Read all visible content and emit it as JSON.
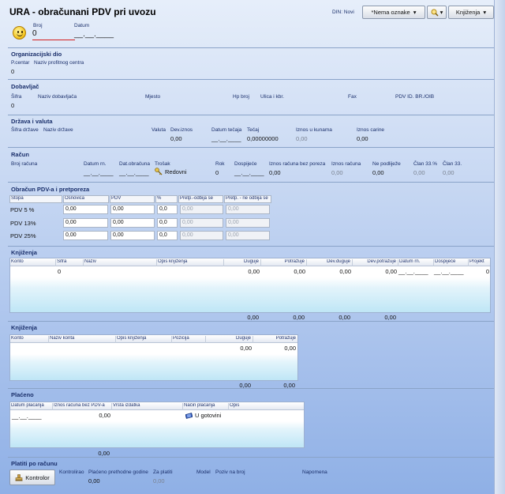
{
  "window": {
    "title": "URA - obračunani PDV pri uvozu"
  },
  "header": {
    "din_label": "DIN: Novi",
    "tag_select": "*Nema oznake",
    "tag_arrow": "▾",
    "search_arrow": "▾",
    "booking_select": "Knjiženja",
    "booking_arrow": "▾"
  },
  "doc": {
    "broj_label": "Broj",
    "broj_value": "0",
    "datum_label": "Datum",
    "datum_value": "__.__.____"
  },
  "org": {
    "section": "Organizacijski dio",
    "pcentar_label": "P.centar",
    "naziv_label": "Naziv profitnog centra",
    "pcentar_value": "0"
  },
  "supplier": {
    "section": "Dobavljač",
    "sifra_label": "Šifra",
    "naziv_label": "Naziv dobavljača",
    "mjesto_label": "Mjesto",
    "hp_label": "Hp broj",
    "ulica_label": "Ulica i kbr.",
    "fax_label": "Fax",
    "pdv_label": "PDV ID. BR./OIB",
    "sifra_value": "0"
  },
  "country": {
    "section": "Država i valuta",
    "sifra_label": "Šifra države",
    "naziv_label": "Naziv države",
    "valuta_label": "Valuta",
    "dev_iznos_label": "Dev.iznos",
    "datum_tecaja_label": "Datum tečaja",
    "tecaj_label": "Tečaj",
    "iznos_kune_label": "Iznos u kunama",
    "iznos_carine_label": "Iznos carine",
    "dev_iznos_value": "0,00",
    "datum_tecaja_value": "__.__.____",
    "tecaj_value": "0,00000000",
    "iznos_kune_value": "0,00",
    "iznos_carine_value": "0,00"
  },
  "invoice": {
    "section": "Račun",
    "broj_label": "Broj računa",
    "datum_rn_label": "Datum rn.",
    "dat_obr_label": "Dat.obračuna",
    "trosak_label": "Trošak",
    "rok_label": "Rok",
    "dospijece_label": "Dospijeće",
    "iznos_bez_label": "Iznos računa bez poreza",
    "iznos_label": "Iznos računa",
    "ne_podlijeze_label": "Ne podliježe",
    "clan33p_label": "Član 33.%",
    "clan33_label": "Član 33.",
    "datum_rn_value": "__.__.____",
    "dat_obr_value": "__.__.____",
    "trosak_value": "Redovni",
    "rok_value": "0",
    "dospijece_value": "__.__.____",
    "iznos_bez_value": "0,00",
    "iznos_value": "0,00",
    "ne_podlijeze_value": "0,00",
    "clan33p_value": "0,00",
    "clan33_value": "0,00"
  },
  "vat": {
    "section": "Obračun PDV-a i pretporeza",
    "headers": [
      "Stopa",
      "Osnovica",
      "PDV",
      "%",
      "Pretp.-odbija se",
      "Pretp. - ne odbija se"
    ],
    "rows": [
      {
        "label": "PDV 5 %",
        "osnovica": "0,00",
        "pdv": "0,00",
        "pct": "0,0",
        "odbija": "0,00",
        "ne_odbija": "0,00"
      },
      {
        "label": "PDV 13%",
        "osnovica": "0,00",
        "pdv": "0,00",
        "pct": "0,0",
        "odbija": "0,00",
        "ne_odbija": "0,00"
      },
      {
        "label": "PDV 25%",
        "osnovica": "0,00",
        "pdv": "0,00",
        "pct": "0,0",
        "odbija": "0,00",
        "ne_odbija": "0,00"
      }
    ]
  },
  "bookings1": {
    "section": "Knjiženja",
    "headers": [
      "Konto",
      "Šifra",
      "Naziv",
      "Opis knjiženja",
      "Duguje",
      "Potražuje",
      "Dev.duguje",
      "Dev.potražuje",
      "Datum rn.",
      "Dospijeće",
      "Projekt"
    ],
    "row": {
      "sifra": "0",
      "duguje": "0,00",
      "potrazuje": "0,00",
      "dev_duguje": "0,00",
      "dev_potrazuje": "0,00",
      "datum": "__.__.____",
      "dospijece": "__.__.____",
      "projekt": "0"
    },
    "totals": {
      "duguje": "0,00",
      "potrazuje": "0,00",
      "dev_duguje": "0,00",
      "dev_potrazuje": "0,00"
    }
  },
  "bookings2": {
    "section": "Knjiženja",
    "headers": [
      "Konto",
      "Naziv konta",
      "Opis knjiženja",
      "Pozicija",
      "Duguje",
      "Potražuje"
    ],
    "row": {
      "duguje": "0,00",
      "potrazuje": "0,00"
    },
    "totals": {
      "duguje": "0,00",
      "potrazuje": "0,00"
    }
  },
  "paid": {
    "section": "Plaćeno",
    "headers": [
      "Datum plaćanja",
      "Iznos računa bez PDV-a",
      "Vrsta izdatka",
      "Način plaćanja",
      "Opis"
    ],
    "row": {
      "datum": "__.__.____",
      "iznos": "0,00",
      "nacin": "U gotovini"
    },
    "total": "0,00"
  },
  "pay_by_invoice": {
    "section": "Platiti po računu",
    "kontrolor_button": "Kontrolor",
    "kontrolirao_label": "Kontrolirao",
    "placeno_label": "Plaćeno prethodne godine",
    "za_platiti_label": "Za platiti",
    "model_label": "Model",
    "poziv_label": "Poziv na broj",
    "napomena_label": "Napomena",
    "placeno_value": "0,00",
    "za_platiti_value": "0,00"
  }
}
